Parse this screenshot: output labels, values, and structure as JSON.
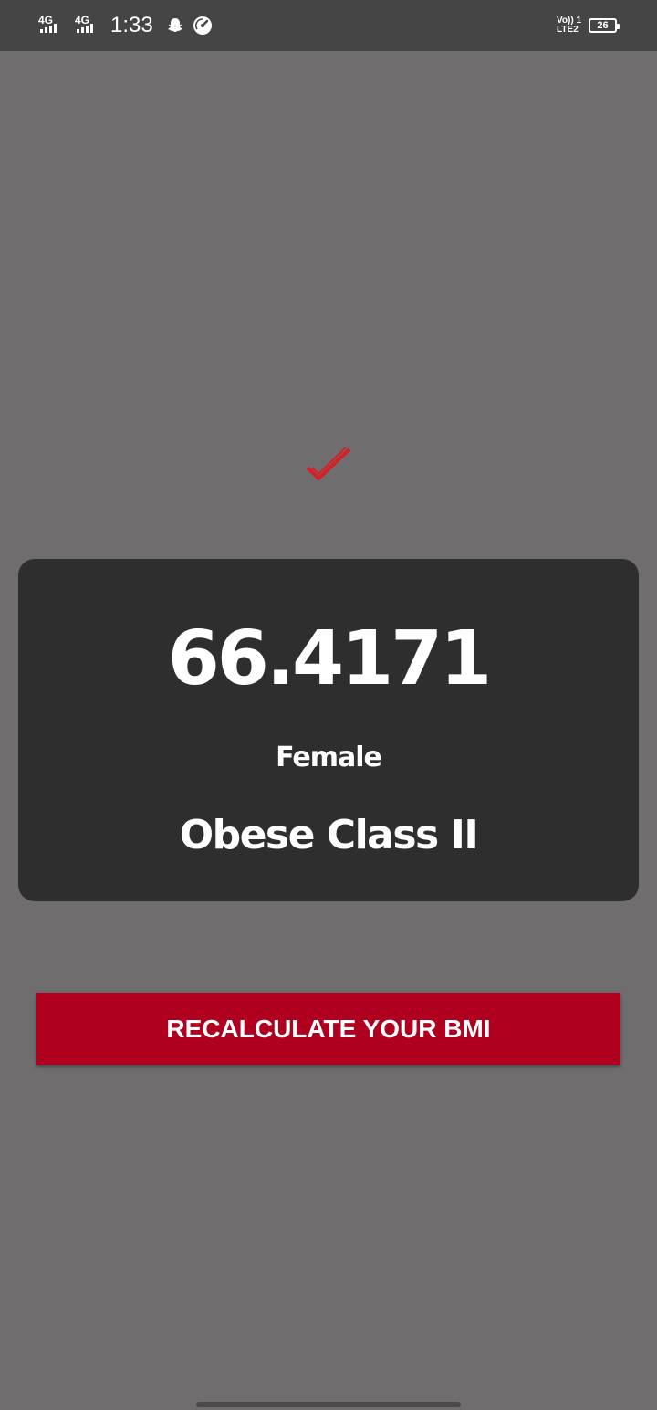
{
  "status_bar": {
    "sim1_network": "4G",
    "sim2_network": "4G",
    "time": "1:33",
    "volte_line1": "Vo)) 1",
    "volte_line2": "LTE2",
    "battery_level": "26",
    "icons": [
      "signal-icon",
      "signal-icon",
      "snapchat-ghost-icon",
      "speedometer-icon",
      "battery-icon"
    ]
  },
  "result": {
    "status_icon": "checkmark-icon",
    "bmi_value": "66.4171",
    "gender": "Female",
    "category": "Obese Class II"
  },
  "actions": {
    "recalculate_label": "RECALCULATE YOUR BMI"
  },
  "colors": {
    "background": "#6f6d6e",
    "status_bar": "#454545",
    "card": "#2e2e2e",
    "accent": "#b00020",
    "check": "#d62027",
    "text": "#ffffff"
  }
}
